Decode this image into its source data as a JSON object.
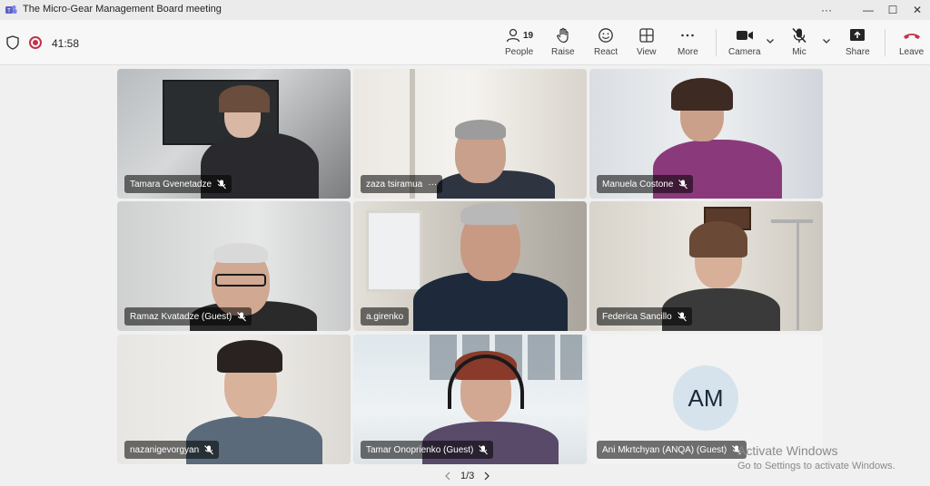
{
  "window": {
    "title": "The Micro-Gear Management Board meeting",
    "controls": [
      "···",
      "—",
      "☐",
      "✕"
    ]
  },
  "toolbar": {
    "timer": "41:58",
    "people_count": "19",
    "people_label": "People",
    "raise_label": "Raise",
    "react_label": "React",
    "view_label": "View",
    "more_label": "More",
    "camera_label": "Camera",
    "mic_label": "Mic",
    "share_label": "Share",
    "leave_label": "Leave"
  },
  "participants": [
    {
      "name": "Tamara Gvenetadze"
    },
    {
      "name": "zaza tsiramua",
      "more": "···"
    },
    {
      "name": "Manuela Costone"
    },
    {
      "name": "Ramaz Kvatadze (Guest)"
    },
    {
      "name": "a.girenko"
    },
    {
      "name": "Federica Sancillo"
    },
    {
      "name": "nazanigevorgyan"
    },
    {
      "name": "Tamar Onoprienko (Guest)"
    },
    {
      "name": "Ani Mkrtchyan (ANQA) (Guest)",
      "initials": "AM"
    }
  ],
  "pager": {
    "text": "1/3"
  },
  "watermark": {
    "line1": "Activate Windows",
    "line2": "Go to Settings to activate Windows."
  },
  "colors": {
    "accent": "#5b5fc7",
    "leave": "#c4314b",
    "avatar_bg": "#d6e3ec"
  }
}
